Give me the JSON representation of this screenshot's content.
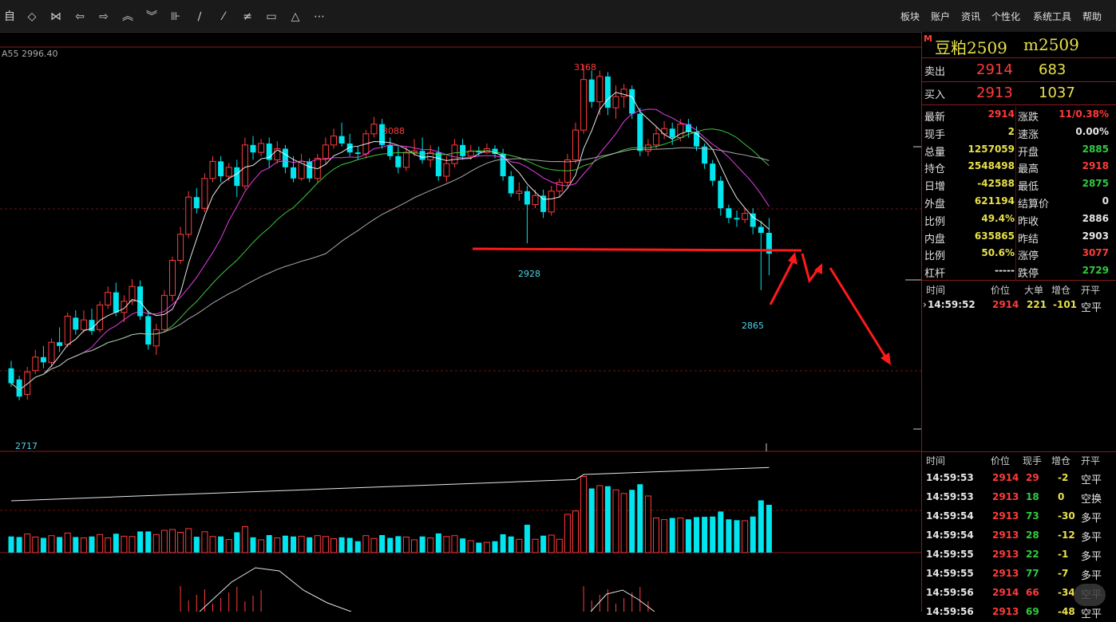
{
  "toolbar": {
    "left_icons": [
      "auto-label",
      "diamond-icon",
      "bowtie-icon",
      "back-arrow-icon",
      "forward-arrow-icon",
      "chevrons-up-icon",
      "chevrons-down-icon",
      "bar-tool-icon",
      "line-icon",
      "dashed-line-icon",
      "parallel-lines-icon",
      "rectangle-icon",
      "triangle-icon",
      "more-icon"
    ],
    "auto_label": "自",
    "menu": [
      "板块",
      "账户",
      "资讯",
      "个性化",
      "系统工具",
      "帮助"
    ]
  },
  "chart": {
    "indicator_label": "A55 2996.40",
    "labels": {
      "high": "3168",
      "mid_high": "3088",
      "mid_low": "2928",
      "recent_low": "2865",
      "low": "2717"
    },
    "colors": {
      "up": "#ff3b3b",
      "down": "#00e5ee",
      "ma1": "#ffffff",
      "ma2": "#ff44ff",
      "ma3": "#44dd44",
      "ma4": "#bbbbbb",
      "annotation": "#ff1a1a"
    }
  },
  "panel": {
    "title_mark": "M",
    "title": "豆粕2509",
    "code": "m2509",
    "sell": {
      "label": "卖出",
      "price": "2914",
      "qty": "683"
    },
    "buy": {
      "label": "买入",
      "price": "2913",
      "qty": "1037"
    },
    "stats": [
      {
        "l1": "最新",
        "v1": "2914",
        "c1": "red",
        "l2": "涨跌",
        "v2": "11/0.38%",
        "c2": "red"
      },
      {
        "l1": "现手",
        "v1": "2",
        "c1": "yellow",
        "l2": "速涨",
        "v2": "0.00%",
        "c2": "white"
      },
      {
        "l1": "总量",
        "v1": "1257059",
        "c1": "yellow",
        "l2": "开盘",
        "v2": "2885",
        "c2": "green"
      },
      {
        "l1": "持仓",
        "v1": "2548498",
        "c1": "yellow",
        "l2": "最高",
        "v2": "2918",
        "c2": "red"
      },
      {
        "l1": "日增",
        "v1": "-42588",
        "c1": "yellow",
        "l2": "最低",
        "v2": "2875",
        "c2": "green"
      },
      {
        "l1": "外盘",
        "v1": "621194",
        "c1": "yellow",
        "l2": "结算价",
        "v2": "0",
        "c2": "white"
      },
      {
        "l1": "比例",
        "v1": "49.4%",
        "c1": "yellow",
        "l2": "昨收",
        "v2": "2886",
        "c2": "white"
      },
      {
        "l1": "内盘",
        "v1": "635865",
        "c1": "yellow",
        "l2": "昨结",
        "v2": "2903",
        "c2": "white"
      },
      {
        "l1": "比例",
        "v1": "50.6%",
        "c1": "yellow",
        "l2": "涨停",
        "v2": "3077",
        "c2": "red"
      },
      {
        "l1": "杠杆",
        "v1": "-----",
        "c1": "white",
        "l2": "跌停",
        "v2": "2729",
        "c2": "green"
      }
    ],
    "big_header": {
      "time": "时间",
      "price": "价位",
      "size": "大单",
      "oi": "增仓",
      "type": "开平"
    },
    "big_trades": [
      {
        "time": "14:59:52",
        "price": "2914",
        "size": "221",
        "oi": "-101",
        "type": "空平"
      }
    ],
    "tick_header": {
      "time": "时间",
      "price": "价位",
      "size": "现手",
      "oi": "增仓",
      "type": "开平"
    },
    "ticks": [
      {
        "time": "14:59:53",
        "price": "2914",
        "pc": "red",
        "size": "29",
        "sc": "red",
        "oi": "-2",
        "type": "空平"
      },
      {
        "time": "14:59:53",
        "price": "2913",
        "pc": "red",
        "size": "18",
        "sc": "green",
        "oi": "0",
        "type": "空换"
      },
      {
        "time": "14:59:54",
        "price": "2913",
        "pc": "red",
        "size": "73",
        "sc": "green",
        "oi": "-30",
        "type": "多平"
      },
      {
        "time": "14:59:54",
        "price": "2913",
        "pc": "red",
        "size": "28",
        "sc": "green",
        "oi": "-12",
        "type": "多平"
      },
      {
        "time": "14:59:55",
        "price": "2913",
        "pc": "red",
        "size": "22",
        "sc": "green",
        "oi": "-1",
        "type": "多平"
      },
      {
        "time": "14:59:55",
        "price": "2913",
        "pc": "red",
        "size": "77",
        "sc": "green",
        "oi": "-7",
        "type": "多平"
      },
      {
        "time": "14:59:56",
        "price": "2914",
        "pc": "red",
        "size": "66",
        "sc": "red",
        "oi": "-34",
        "type": "空平"
      },
      {
        "time": "14:59:56",
        "price": "2913",
        "pc": "red",
        "size": "69",
        "sc": "green",
        "oi": "-48",
        "type": "空平"
      }
    ]
  }
}
